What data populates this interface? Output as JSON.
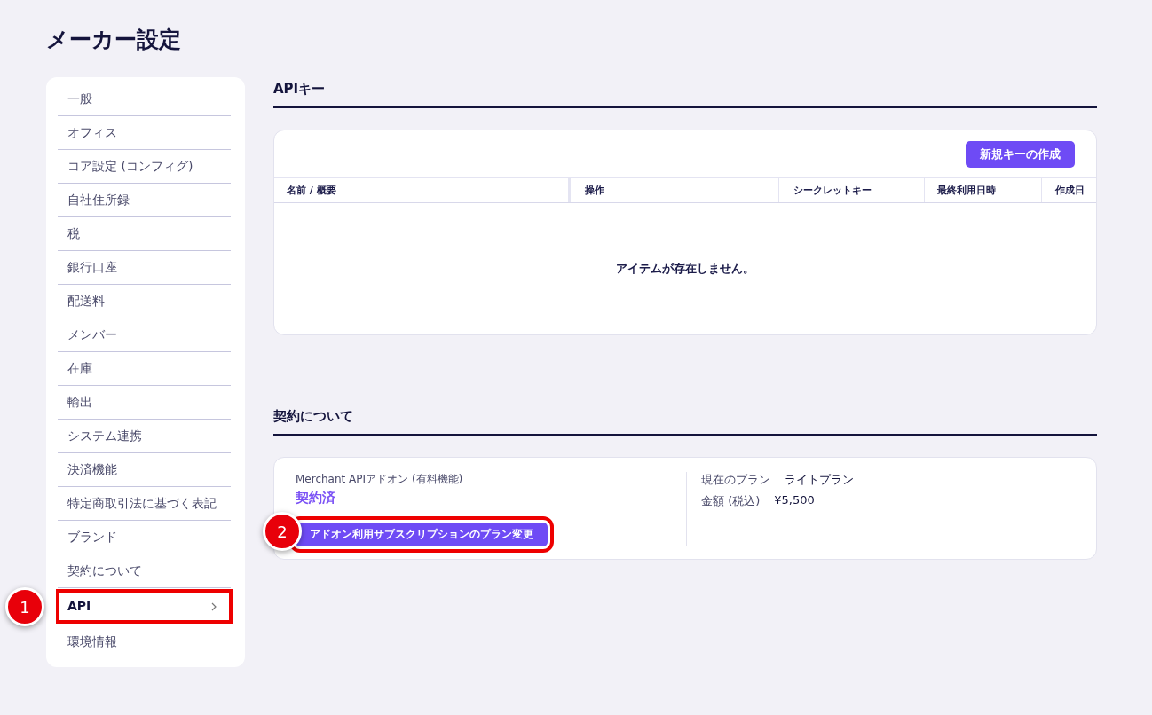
{
  "page_title": "メーカー設定",
  "sidebar": {
    "items": [
      {
        "label": "一般",
        "selected": false
      },
      {
        "label": "オフィス",
        "selected": false
      },
      {
        "label": "コア設定 (コンフィグ)",
        "selected": false
      },
      {
        "label": "自社住所録",
        "selected": false
      },
      {
        "label": "税",
        "selected": false
      },
      {
        "label": "銀行口座",
        "selected": false
      },
      {
        "label": "配送料",
        "selected": false
      },
      {
        "label": "メンバー",
        "selected": false
      },
      {
        "label": "在庫",
        "selected": false
      },
      {
        "label": "輸出",
        "selected": false
      },
      {
        "label": "システム連携",
        "selected": false
      },
      {
        "label": "決済機能",
        "selected": false
      },
      {
        "label": "特定商取引法に基づく表記",
        "selected": false
      },
      {
        "label": "ブランド",
        "selected": false
      },
      {
        "label": "契約について",
        "selected": false
      },
      {
        "label": "API",
        "selected": true,
        "callout": "1"
      },
      {
        "label": "環境情報",
        "selected": false
      }
    ]
  },
  "api_keys": {
    "heading": "APIキー",
    "create_button": "新規キーの作成",
    "table": {
      "columns": [
        "名前 / 概要",
        "操作",
        "シークレットキー",
        "最終利用日時",
        "作成日"
      ],
      "empty_message": "アイテムが存在しません。"
    }
  },
  "contract": {
    "heading": "契約について",
    "addon_label": "Merchant APIアドオン (有料機能)",
    "status": "契約済",
    "change_button": {
      "label": "アドオン利用サブスクリプションのプラン変更",
      "callout": "2"
    },
    "details": [
      {
        "label": "現在のプラン",
        "value": "ライトプラン"
      },
      {
        "label": "金額 (税込)",
        "value": "¥5,500"
      }
    ]
  }
}
